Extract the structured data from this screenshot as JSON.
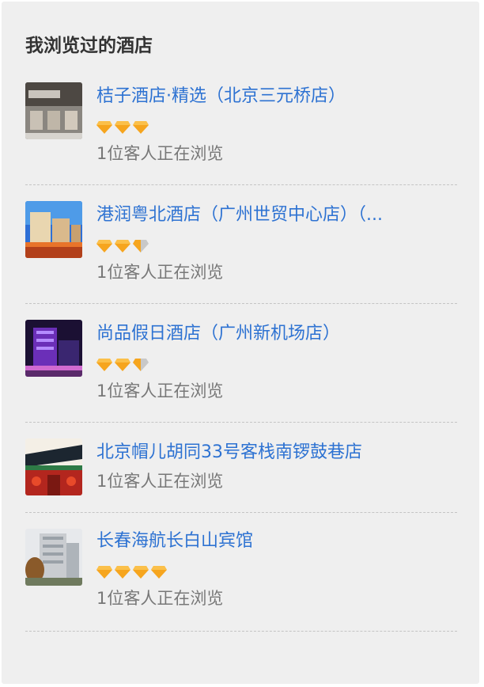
{
  "section": {
    "title": "我浏览过的酒店"
  },
  "hotels": [
    {
      "name": "桔子酒店·精选（北京三元桥店）",
      "diamonds": 3,
      "diamonds_total": 3,
      "viewing": "1位客人正在浏览"
    },
    {
      "name": "港润粤北酒店（广州世贸中心店）（...",
      "diamonds": 2.5,
      "diamonds_total": 3,
      "viewing": "1位客人正在浏览"
    },
    {
      "name": "尚品假日酒店（广州新机场店）",
      "diamonds": 2.5,
      "diamonds_total": 3,
      "viewing": "1位客人正在浏览"
    },
    {
      "name": "北京帽儿胡同33号客栈南锣鼓巷店",
      "diamonds": 0,
      "diamonds_total": 0,
      "viewing": "1位客人正在浏览"
    },
    {
      "name": "长春海航长白山宾馆",
      "diamonds": 4,
      "diamonds_total": 4,
      "viewing": "1位客人正在浏览"
    }
  ],
  "colors": {
    "link": "#2d72d2",
    "diamond_gold": "#f6a51e",
    "diamond_gray": "#c8c8c8",
    "panel_bg": "#efefef"
  }
}
